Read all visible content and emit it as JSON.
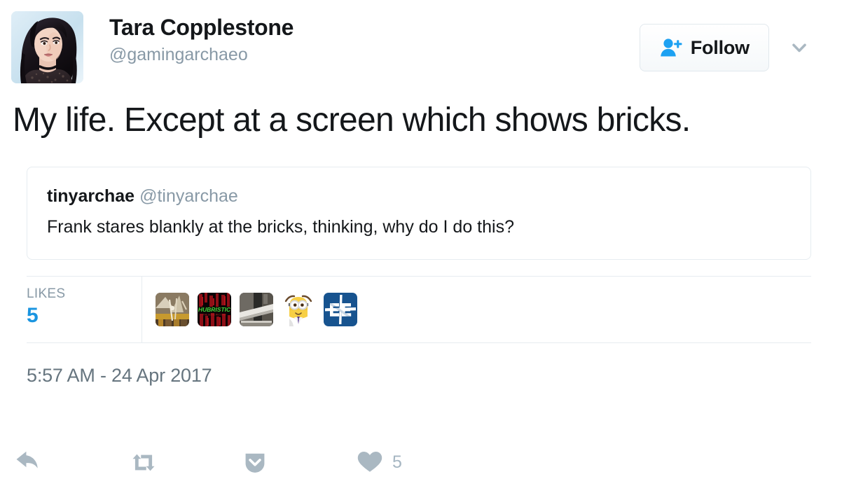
{
  "author": {
    "display_name": "Tara Copplestone",
    "handle": "@gamingarchaeo",
    "avatar_icon": "user-photo-avatar"
  },
  "header": {
    "follow_label": "Follow",
    "follow_icon": "person-plus-icon",
    "caret_icon": "chevron-down-icon"
  },
  "tweet": {
    "text": "My life. Except at a screen which shows bricks."
  },
  "quoted_tweet": {
    "display_name": "tinyarchae",
    "handle": "@tinyarchae",
    "text": "Frank stares blankly at the bricks, thinking, why do I do this?"
  },
  "likes": {
    "label": "LIKES",
    "count": "5",
    "accent_color": "#1b95e0",
    "likers": [
      {
        "name": "liker-avatar-excavation",
        "alt": "archaeology excavation photo"
      },
      {
        "name": "liker-avatar-hubristic",
        "alt": "hubristic red green text art"
      },
      {
        "name": "liker-avatar-greyscale-object",
        "alt": "greyscale object photo"
      },
      {
        "name": "liker-avatar-minion",
        "alt": "cartoon minion character"
      },
      {
        "name": "liker-avatar-ee-logo",
        "alt": "blue EE monogram logo"
      }
    ]
  },
  "timestamp": "5:57 AM - 24 Apr 2017",
  "actions": [
    {
      "name": "reply-button",
      "icon": "reply-arrow-icon",
      "count": ""
    },
    {
      "name": "retweet-button",
      "icon": "retweet-icon",
      "count": ""
    },
    {
      "name": "more-button",
      "icon": "shield-chevron-down-icon",
      "count": ""
    },
    {
      "name": "like-button",
      "icon": "heart-icon",
      "count": "5"
    }
  ],
  "colors": {
    "twitter_blue": "#1da1f2",
    "muted_gray": "#8899a6",
    "icon_gray": "#aab8c2",
    "border": "#e6ecf0",
    "text": "#14171a"
  }
}
